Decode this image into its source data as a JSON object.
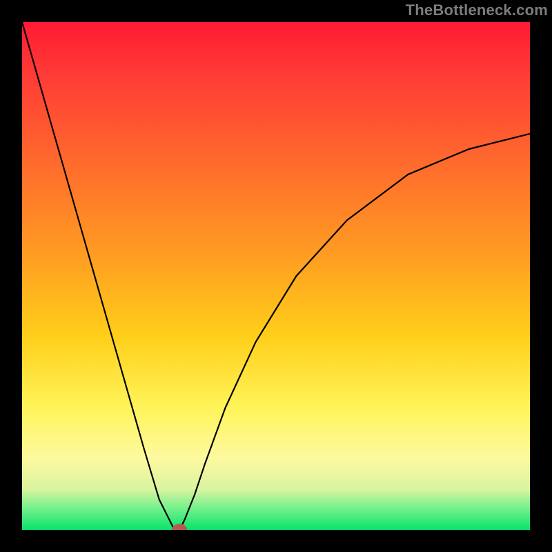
{
  "watermark": "TheBottleneck.com",
  "chart_data": {
    "type": "line",
    "title": "",
    "xlabel": "",
    "ylabel": "",
    "xlim": [
      0,
      100
    ],
    "ylim": [
      0,
      100
    ],
    "grid": false,
    "background_gradient": {
      "direction": "vertical",
      "stops": [
        {
          "pos": 0.0,
          "color": "#ff1a33"
        },
        {
          "pos": 0.28,
          "color": "#ff6b2d"
        },
        {
          "pos": 0.62,
          "color": "#ffcf1a"
        },
        {
          "pos": 0.86,
          "color": "#fdf9a0"
        },
        {
          "pos": 1.0,
          "color": "#09e36a"
        }
      ]
    },
    "series": [
      {
        "name": "bottleneck-curve",
        "color": "#000000",
        "x": [
          0,
          4,
          8,
          12,
          16,
          20,
          24,
          27,
          29,
          30,
          31,
          32,
          34,
          36,
          40,
          46,
          54,
          64,
          76,
          88,
          100
        ],
        "y": [
          100,
          86,
          72,
          58,
          44,
          30,
          16,
          6,
          2,
          0,
          0,
          2,
          7,
          13,
          24,
          37,
          50,
          61,
          70,
          75,
          78
        ]
      }
    ],
    "marker": {
      "name": "minimum-point",
      "x": 31,
      "y": 0,
      "color": "#b85b4a",
      "shape": "ellipse"
    }
  }
}
